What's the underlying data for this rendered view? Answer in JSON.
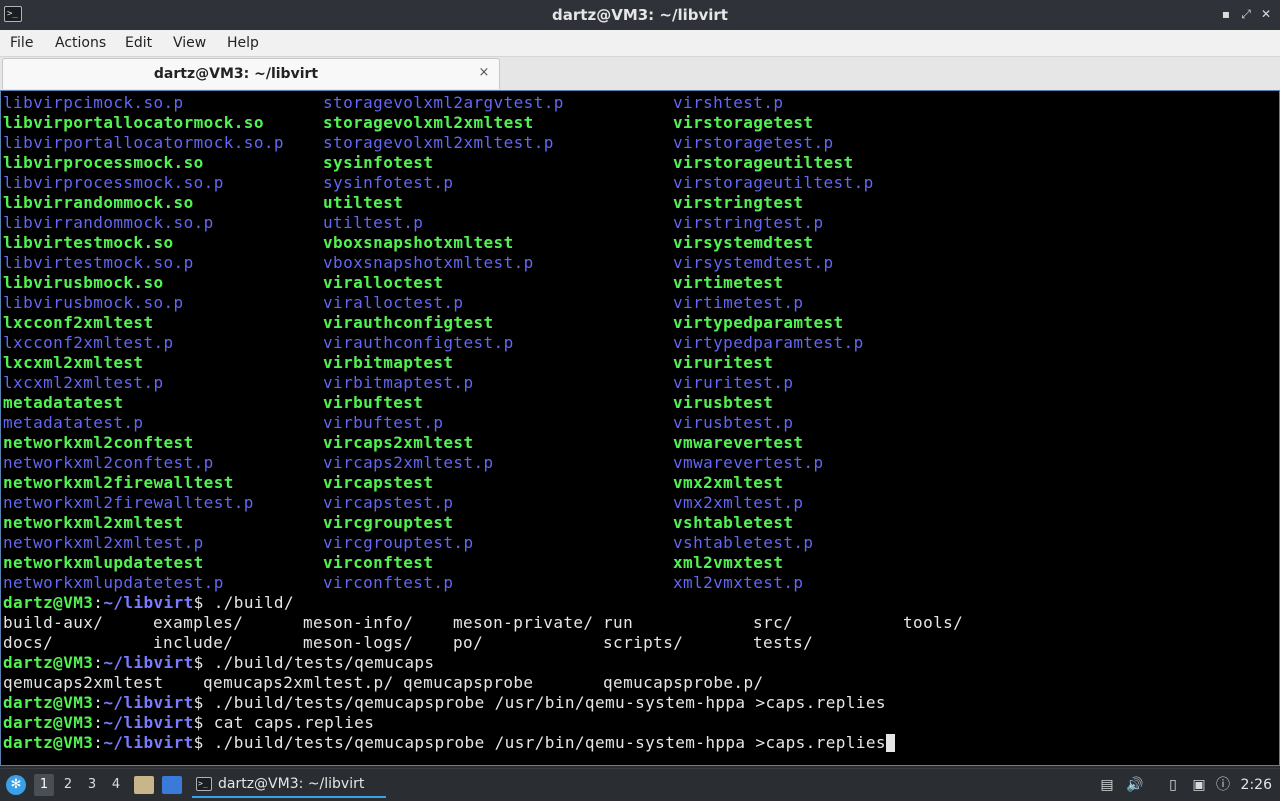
{
  "window": {
    "title": "dartz@VM3: ~/libvirt",
    "icon": "terminal-icon",
    "buttons": [
      "minimize-icon",
      "maximize-icon",
      "close-icon"
    ]
  },
  "menu": {
    "file": "File",
    "actions": "Actions",
    "edit": "Edit",
    "view": "View",
    "help": "Help"
  },
  "tab": {
    "label": "dartz@VM3: ~/libvirt",
    "close_glyph": "×"
  },
  "terminal": {
    "colors": {
      "executable": "#51f251",
      "directory_or_p": "#6366f6",
      "plain": "#e6e6e6",
      "background": "#000000"
    },
    "listing": [
      [
        [
          "libvirpcimock.so.p",
          "d"
        ],
        [
          "storagevolxml2argvtest.p",
          "d"
        ],
        [
          "virshtest.p",
          "d"
        ]
      ],
      [
        [
          "libvirportallocatormock.so",
          "e"
        ],
        [
          "storagevolxml2xmltest",
          "e"
        ],
        [
          "virstoragetest",
          "e"
        ]
      ],
      [
        [
          "libvirportallocatormock.so.p",
          "d"
        ],
        [
          "storagevolxml2xmltest.p",
          "d"
        ],
        [
          "virstoragetest.p",
          "d"
        ]
      ],
      [
        [
          "libvirprocessmock.so",
          "e"
        ],
        [
          "sysinfotest",
          "e"
        ],
        [
          "virstorageutiltest",
          "e"
        ]
      ],
      [
        [
          "libvirprocessmock.so.p",
          "d"
        ],
        [
          "sysinfotest.p",
          "d"
        ],
        [
          "virstorageutiltest.p",
          "d"
        ]
      ],
      [
        [
          "libvirrandommock.so",
          "e"
        ],
        [
          "utiltest",
          "e"
        ],
        [
          "virstringtest",
          "e"
        ]
      ],
      [
        [
          "libvirrandommock.so.p",
          "d"
        ],
        [
          "utiltest.p",
          "d"
        ],
        [
          "virstringtest.p",
          "d"
        ]
      ],
      [
        [
          "libvirtestmock.so",
          "e"
        ],
        [
          "vboxsnapshotxmltest",
          "e"
        ],
        [
          "virsystemdtest",
          "e"
        ]
      ],
      [
        [
          "libvirtestmock.so.p",
          "d"
        ],
        [
          "vboxsnapshotxmltest.p",
          "d"
        ],
        [
          "virsystemdtest.p",
          "d"
        ]
      ],
      [
        [
          "libvirusbmock.so",
          "e"
        ],
        [
          "viralloctest",
          "e"
        ],
        [
          "virtimetest",
          "e"
        ]
      ],
      [
        [
          "libvirusbmock.so.p",
          "d"
        ],
        [
          "viralloctest.p",
          "d"
        ],
        [
          "virtimetest.p",
          "d"
        ]
      ],
      [
        [
          "lxcconf2xmltest",
          "e"
        ],
        [
          "virauthconfigtest",
          "e"
        ],
        [
          "virtypedparamtest",
          "e"
        ]
      ],
      [
        [
          "lxcconf2xmltest.p",
          "d"
        ],
        [
          "virauthconfigtest.p",
          "d"
        ],
        [
          "virtypedparamtest.p",
          "d"
        ]
      ],
      [
        [
          "lxcxml2xmltest",
          "e"
        ],
        [
          "virbitmaptest",
          "e"
        ],
        [
          "viruritest",
          "e"
        ]
      ],
      [
        [
          "lxcxml2xmltest.p",
          "d"
        ],
        [
          "virbitmaptest.p",
          "d"
        ],
        [
          "viruritest.p",
          "d"
        ]
      ],
      [
        [
          "metadatatest",
          "e"
        ],
        [
          "virbuftest",
          "e"
        ],
        [
          "virusbtest",
          "e"
        ]
      ],
      [
        [
          "metadatatest.p",
          "d"
        ],
        [
          "virbuftest.p",
          "d"
        ],
        [
          "virusbtest.p",
          "d"
        ]
      ],
      [
        [
          "networkxml2conftest",
          "e"
        ],
        [
          "vircaps2xmltest",
          "e"
        ],
        [
          "vmwarevertest",
          "e"
        ]
      ],
      [
        [
          "networkxml2conftest.p",
          "d"
        ],
        [
          "vircaps2xmltest.p",
          "d"
        ],
        [
          "vmwarevertest.p",
          "d"
        ]
      ],
      [
        [
          "networkxml2firewalltest",
          "e"
        ],
        [
          "vircapstest",
          "e"
        ],
        [
          "vmx2xmltest",
          "e"
        ]
      ],
      [
        [
          "networkxml2firewalltest.p",
          "d"
        ],
        [
          "vircapstest.p",
          "d"
        ],
        [
          "vmx2xmltest.p",
          "d"
        ]
      ],
      [
        [
          "networkxml2xmltest",
          "e"
        ],
        [
          "vircgrouptest",
          "e"
        ],
        [
          "vshtabletest",
          "e"
        ]
      ],
      [
        [
          "networkxml2xmltest.p",
          "d"
        ],
        [
          "vircgrouptest.p",
          "d"
        ],
        [
          "vshtabletest.p",
          "d"
        ]
      ],
      [
        [
          "networkxmlupdatetest",
          "e"
        ],
        [
          "virconftest",
          "e"
        ],
        [
          "xml2vmxtest",
          "e"
        ]
      ],
      [
        [
          "networkxmlupdatetest.p",
          "d"
        ],
        [
          "virconftest.p",
          "d"
        ],
        [
          "xml2vmxtest.p",
          "d"
        ]
      ]
    ],
    "prompt_user": "dartz@VM3",
    "prompt_sep": ":",
    "prompt_path": "~/libvirt",
    "prompt_sign": "$",
    "session": [
      {
        "type": "cmd",
        "text": " ./build/"
      },
      {
        "type": "out",
        "cells": [
          "build-aux/",
          "examples/",
          "meson-info/",
          "meson-private/",
          "run",
          "src/",
          "tools/"
        ]
      },
      {
        "type": "out",
        "cells": [
          "docs/",
          "include/",
          "meson-logs/",
          "po/",
          "scripts/",
          "tests/"
        ]
      },
      {
        "type": "cmd",
        "text": " ./build/tests/qemucaps"
      },
      {
        "type": "out",
        "cells": [
          "qemucaps2xmltest",
          "qemucaps2xmltest.p/",
          "qemucapsprobe",
          "qemucapsprobe.p/"
        ]
      },
      {
        "type": "cmd",
        "text": " ./build/tests/qemucapsprobe /usr/bin/qemu-system-hppa >caps.replies"
      },
      {
        "type": "cmd",
        "text": " cat caps.replies"
      },
      {
        "type": "cmd",
        "text": " ./build/tests/qemucapsprobe /usr/bin/qemu-system-hppa >caps.replies",
        "cursor": true
      }
    ]
  },
  "taskbar": {
    "workspaces": [
      "1",
      "2",
      "3",
      "4"
    ],
    "active_workspace": "1",
    "launchers": [
      "file-manager-icon",
      "desktop-icon"
    ],
    "task_label": "dartz@VM3: ~/libvirt",
    "tray": [
      "storage-icon",
      "volume-icon",
      "clipboard-icon",
      "network-icon",
      "notification-icon"
    ],
    "clock": "2:26"
  }
}
